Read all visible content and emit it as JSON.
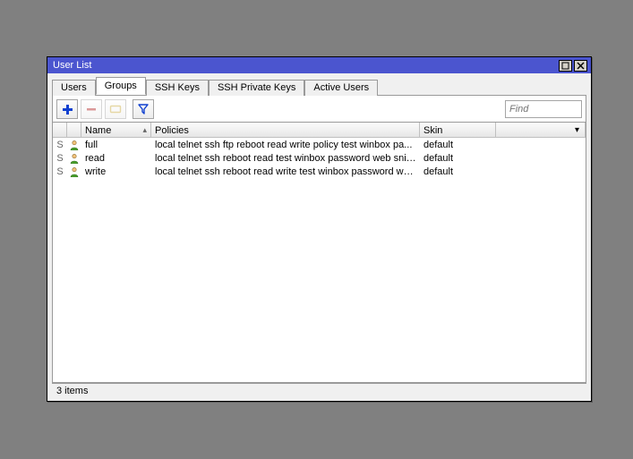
{
  "window": {
    "title": "User List"
  },
  "tabs": [
    {
      "label": "Users",
      "active": false
    },
    {
      "label": "Groups",
      "active": true
    },
    {
      "label": "SSH Keys",
      "active": false
    },
    {
      "label": "SSH Private Keys",
      "active": false
    },
    {
      "label": "Active Users",
      "active": false
    }
  ],
  "toolbar": {
    "find_placeholder": "Find"
  },
  "grid": {
    "columns": {
      "name": "Name",
      "policies": "Policies",
      "skin": "Skin"
    },
    "sort_indicator": "▴",
    "dropdown_indicator": "▾",
    "rows": [
      {
        "flag": "S",
        "name": "full",
        "policies": "local telnet ssh ftp reboot read write policy test winbox pa...",
        "skin": "default"
      },
      {
        "flag": "S",
        "name": "read",
        "policies": "local telnet ssh reboot read test winbox password web snif...",
        "skin": "default"
      },
      {
        "flag": "S",
        "name": "write",
        "policies": "local telnet ssh reboot read write test winbox password we...",
        "skin": "default"
      }
    ]
  },
  "status": "3 items"
}
